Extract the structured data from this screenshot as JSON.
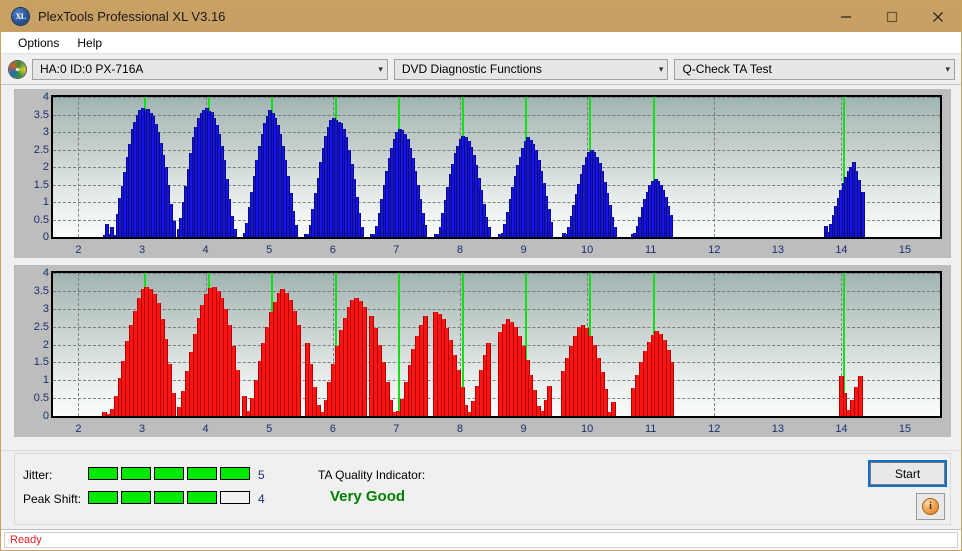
{
  "window": {
    "title": "PlexTools Professional XL V3.16",
    "logo_text": "XL",
    "minimize_icon": "minimize-icon",
    "maximize_icon": "maximize-icon",
    "close_icon": "close-icon"
  },
  "menu": {
    "items": [
      {
        "label": "Options"
      },
      {
        "label": "Help"
      }
    ]
  },
  "selectors": {
    "drive_icon": "disc-icon",
    "drive": "HA:0 ID:0  PX-716A",
    "function": "DVD Diagnostic Functions",
    "test": "Q-Check TA Test",
    "chevron": "⌄"
  },
  "bottom": {
    "jitter_label": "Jitter:",
    "jitter_value": "5",
    "jitter_filled": 5,
    "jitter_total": 5,
    "peak_shift_label": "Peak Shift:",
    "peak_shift_value": "4",
    "peak_shift_filled": 4,
    "peak_shift_total": 5,
    "ta_label": "TA Quality Indicator:",
    "ta_value": "Very Good",
    "ta_color": "#008000",
    "start_label": "Start",
    "info_icon": "info-icon",
    "info_glyph": "i"
  },
  "status": {
    "text": "Ready"
  },
  "chart_data": [
    {
      "type": "bar",
      "name": "jitter-chart",
      "title": "",
      "xlabel": "",
      "ylabel": "",
      "series_color": "#1414e6",
      "xlim": [
        1.6,
        15.55
      ],
      "ylim": [
        0,
        4
      ],
      "yticks": [
        0,
        0.5,
        1,
        1.5,
        2,
        2.5,
        3,
        3.5,
        4
      ],
      "ytick_labels": [
        "0",
        "0.5",
        "1",
        "1.5",
        "2",
        "2.5",
        "3",
        "3.5",
        "4"
      ],
      "xticks": [
        2,
        3,
        4,
        5,
        6,
        7,
        8,
        9,
        10,
        11,
        12,
        13,
        14,
        15
      ],
      "xtick_labels": [
        "2",
        "3",
        "4",
        "5",
        "6",
        "7",
        "8",
        "9",
        "10",
        "11",
        "12",
        "13",
        "14",
        "15"
      ],
      "grid": true,
      "markers": [
        3.03,
        4.03,
        5.03,
        6.03,
        7.03,
        8.03,
        9.03,
        10.03,
        11.03,
        14.03
      ],
      "bar_width": 0.028,
      "x": [
        2.4,
        2.44,
        2.48,
        2.52,
        2.56,
        2.6,
        2.64,
        2.68,
        2.72,
        2.76,
        2.8,
        2.84,
        2.88,
        2.92,
        2.96,
        3.0,
        3.04,
        3.08,
        3.12,
        3.16,
        3.2,
        3.24,
        3.28,
        3.32,
        3.36,
        3.4,
        3.44,
        3.48,
        3.56,
        3.6,
        3.64,
        3.68,
        3.72,
        3.76,
        3.8,
        3.84,
        3.88,
        3.92,
        3.96,
        4.0,
        4.04,
        4.08,
        4.12,
        4.16,
        4.2,
        4.24,
        4.28,
        4.32,
        4.36,
        4.4,
        4.44,
        4.6,
        4.64,
        4.68,
        4.72,
        4.76,
        4.8,
        4.84,
        4.88,
        4.92,
        4.96,
        5.0,
        5.04,
        5.08,
        5.12,
        5.16,
        5.2,
        5.24,
        5.28,
        5.32,
        5.36,
        5.4,
        5.56,
        5.6,
        5.64,
        5.68,
        5.72,
        5.76,
        5.8,
        5.84,
        5.88,
        5.92,
        5.96,
        6.0,
        6.04,
        6.08,
        6.12,
        6.16,
        6.2,
        6.24,
        6.28,
        6.32,
        6.36,
        6.4,
        6.44,
        6.6,
        6.64,
        6.68,
        6.72,
        6.76,
        6.8,
        6.84,
        6.88,
        6.92,
        6.96,
        7.0,
        7.04,
        7.08,
        7.12,
        7.16,
        7.2,
        7.24,
        7.28,
        7.32,
        7.36,
        7.4,
        7.44,
        7.6,
        7.64,
        7.68,
        7.72,
        7.76,
        7.8,
        7.84,
        7.88,
        7.92,
        7.96,
        8.0,
        8.04,
        8.08,
        8.12,
        8.16,
        8.2,
        8.24,
        8.28,
        8.32,
        8.36,
        8.4,
        8.44,
        8.62,
        8.66,
        8.7,
        8.74,
        8.78,
        8.82,
        8.86,
        8.9,
        8.94,
        8.98,
        9.02,
        9.06,
        9.1,
        9.14,
        9.18,
        9.22,
        9.26,
        9.3,
        9.34,
        9.38,
        9.42,
        9.62,
        9.66,
        9.7,
        9.74,
        9.78,
        9.82,
        9.86,
        9.9,
        9.94,
        9.98,
        10.02,
        10.06,
        10.1,
        10.14,
        10.18,
        10.22,
        10.26,
        10.3,
        10.34,
        10.38,
        10.42,
        10.7,
        10.74,
        10.78,
        10.82,
        10.86,
        10.9,
        10.94,
        10.98,
        11.02,
        11.06,
        11.1,
        11.14,
        11.18,
        11.22,
        11.26,
        11.3,
        13.74,
        13.78,
        13.82,
        13.86,
        13.9,
        13.94,
        13.98,
        14.02,
        14.06,
        14.1,
        14.14,
        14.18,
        14.22,
        14.26,
        14.32
      ],
      "values": [
        0.06,
        0.36,
        0.1,
        0.3,
        0.06,
        0.65,
        1.12,
        1.45,
        1.85,
        2.3,
        2.65,
        3.1,
        3.3,
        3.5,
        3.62,
        3.7,
        3.62,
        3.67,
        3.55,
        3.45,
        3.22,
        3.0,
        2.7,
        2.35,
        2.0,
        1.5,
        0.95,
        0.45,
        0.22,
        0.55,
        1.0,
        1.45,
        1.95,
        2.4,
        2.85,
        3.15,
        3.4,
        3.55,
        3.62,
        3.7,
        3.6,
        3.58,
        3.4,
        3.2,
        2.95,
        2.6,
        2.2,
        1.65,
        1.1,
        0.6,
        0.22,
        0.12,
        0.4,
        0.85,
        1.3,
        1.75,
        2.2,
        2.6,
        2.95,
        3.25,
        3.45,
        3.62,
        3.55,
        3.4,
        3.2,
        2.95,
        2.6,
        2.2,
        1.75,
        1.25,
        0.75,
        0.35,
        0.1,
        0.08,
        0.35,
        0.8,
        1.25,
        1.7,
        2.15,
        2.55,
        2.9,
        3.15,
        3.35,
        3.4,
        3.35,
        3.3,
        3.25,
        3.1,
        2.85,
        2.5,
        2.1,
        1.65,
        1.15,
        0.7,
        0.3,
        0.08,
        0.1,
        0.32,
        0.7,
        1.1,
        1.5,
        1.9,
        2.25,
        2.55,
        2.8,
        3.0,
        3.1,
        3.05,
        2.95,
        2.8,
        2.55,
        2.25,
        1.9,
        1.5,
        1.1,
        0.7,
        0.35,
        0.1,
        0.08,
        0.3,
        0.68,
        1.05,
        1.42,
        1.8,
        2.1,
        2.4,
        2.6,
        2.8,
        2.9,
        2.85,
        2.75,
        2.58,
        2.35,
        2.05,
        1.7,
        1.35,
        0.95,
        0.58,
        0.28,
        0.08,
        0.12,
        0.38,
        0.72,
        1.08,
        1.42,
        1.75,
        2.05,
        2.3,
        2.55,
        2.75,
        2.85,
        2.78,
        2.65,
        2.48,
        2.2,
        1.9,
        1.55,
        1.18,
        0.8,
        0.42,
        0.12,
        0.1,
        0.3,
        0.6,
        0.92,
        1.22,
        1.52,
        1.8,
        2.05,
        2.28,
        2.42,
        2.5,
        2.42,
        2.3,
        2.12,
        1.88,
        1.58,
        1.25,
        0.92,
        0.58,
        0.28,
        0.08,
        0.12,
        0.32,
        0.58,
        0.85,
        1.08,
        1.3,
        1.48,
        1.6,
        1.65,
        1.6,
        1.5,
        1.35,
        1.15,
        0.9,
        0.62,
        0.32,
        0.15,
        0.38,
        0.62,
        0.88,
        1.12,
        1.35,
        1.55,
        1.72,
        1.88,
        2.0,
        2.15,
        1.9,
        1.62,
        1.3,
        0.4
      ]
    },
    {
      "type": "bar",
      "name": "peak-shift-chart",
      "title": "",
      "xlabel": "",
      "ylabel": "",
      "series_color": "#ff1414",
      "xlim": [
        1.6,
        15.55
      ],
      "ylim": [
        0,
        4
      ],
      "yticks": [
        0,
        0.5,
        1,
        1.5,
        2,
        2.5,
        3,
        3.5,
        4
      ],
      "ytick_labels": [
        "0",
        "0.5",
        "1",
        "1.5",
        "2",
        "2.5",
        "3",
        "3.5",
        "4"
      ],
      "xticks": [
        2,
        3,
        4,
        5,
        6,
        7,
        8,
        9,
        10,
        11,
        12,
        13,
        14,
        15
      ],
      "xtick_labels": [
        "2",
        "3",
        "4",
        "5",
        "6",
        "7",
        "8",
        "9",
        "10",
        "11",
        "12",
        "13",
        "14",
        "15"
      ],
      "grid": true,
      "markers": [
        3.03,
        4.03,
        5.03,
        6.03,
        7.03,
        8.03,
        9.03,
        10.03,
        11.03,
        14.03
      ],
      "bar_width": 0.046,
      "x": [
        2.4,
        2.46,
        2.52,
        2.58,
        2.64,
        2.7,
        2.76,
        2.82,
        2.88,
        2.94,
        3.0,
        3.06,
        3.12,
        3.18,
        3.24,
        3.3,
        3.36,
        3.42,
        3.48,
        3.58,
        3.64,
        3.7,
        3.76,
        3.82,
        3.88,
        3.94,
        4.0,
        4.06,
        4.12,
        4.18,
        4.24,
        4.3,
        4.36,
        4.42,
        4.48,
        4.6,
        4.66,
        4.72,
        4.78,
        4.84,
        4.9,
        4.96,
        5.02,
        5.08,
        5.14,
        5.2,
        5.26,
        5.32,
        5.38,
        5.44,
        5.58,
        5.64,
        5.7,
        5.76,
        5.82,
        5.88,
        5.94,
        6.0,
        6.06,
        6.12,
        6.18,
        6.24,
        6.3,
        6.36,
        6.42,
        6.48,
        6.6,
        6.66,
        6.72,
        6.78,
        6.84,
        6.9,
        6.96,
        7.02,
        7.08,
        7.14,
        7.2,
        7.26,
        7.32,
        7.38,
        7.44,
        7.6,
        7.66,
        7.72,
        7.78,
        7.84,
        7.9,
        7.96,
        8.02,
        8.08,
        8.14,
        8.2,
        8.26,
        8.32,
        8.38,
        8.44,
        8.62,
        8.68,
        8.74,
        8.8,
        8.86,
        8.92,
        8.98,
        9.04,
        9.1,
        9.16,
        9.22,
        9.28,
        9.34,
        9.4,
        9.62,
        9.68,
        9.74,
        9.8,
        9.86,
        9.92,
        9.98,
        10.04,
        10.1,
        10.16,
        10.22,
        10.28,
        10.34,
        10.4,
        10.72,
        10.78,
        10.84,
        10.9,
        10.96,
        11.02,
        11.08,
        11.14,
        11.2,
        11.26,
        11.32,
        13.98,
        14.04,
        14.1,
        14.16,
        14.22,
        14.28
      ],
      "values": [
        0.1,
        0.05,
        0.2,
        0.55,
        1.05,
        1.55,
        2.1,
        2.55,
        2.95,
        3.3,
        3.55,
        3.62,
        3.55,
        3.4,
        3.15,
        2.7,
        2.15,
        1.45,
        0.65,
        0.25,
        0.7,
        1.25,
        1.8,
        2.3,
        2.75,
        3.1,
        3.4,
        3.58,
        3.62,
        3.5,
        3.3,
        3.0,
        2.55,
        1.95,
        1.3,
        0.55,
        0.15,
        0.5,
        1.0,
        1.55,
        2.05,
        2.5,
        2.9,
        3.2,
        3.45,
        3.55,
        3.45,
        3.25,
        2.95,
        2.55,
        2.05,
        1.45,
        0.8,
        0.3,
        0.12,
        0.45,
        0.95,
        1.45,
        1.95,
        2.4,
        2.75,
        3.05,
        3.25,
        3.3,
        3.22,
        3.05,
        2.8,
        2.45,
        2.0,
        1.5,
        0.95,
        0.45,
        0.1,
        0.15,
        0.48,
        0.95,
        1.42,
        1.88,
        2.25,
        2.55,
        2.8,
        2.92,
        2.85,
        2.7,
        2.45,
        2.12,
        1.72,
        1.28,
        0.8,
        0.32,
        0.12,
        0.42,
        0.85,
        1.28,
        1.7,
        2.05,
        2.35,
        2.58,
        2.7,
        2.62,
        2.48,
        2.25,
        1.95,
        1.58,
        1.15,
        0.72,
        0.28,
        0.15,
        0.45,
        0.85,
        1.25,
        1.62,
        1.95,
        2.25,
        2.48,
        2.55,
        2.45,
        2.25,
        1.98,
        1.62,
        1.22,
        0.75,
        0.12,
        0.4,
        0.78,
        1.15,
        1.5,
        1.82,
        2.08,
        2.28,
        2.38,
        2.3,
        2.12,
        1.85,
        1.52,
        1.12,
        0.65,
        0.18,
        0.45,
        0.8,
        1.12,
        1.4,
        1.62,
        1.72,
        1.65,
        1.48,
        1.22,
        0.85,
        0.05,
        1.1,
        0.9,
        1.15,
        1.05,
        0.9
      ]
    }
  ]
}
